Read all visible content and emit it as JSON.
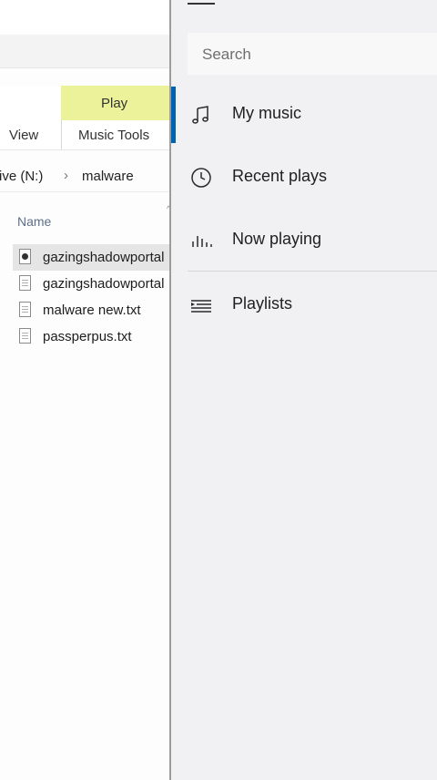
{
  "explorer": {
    "ribbon": {
      "view_tab": "View",
      "contextual_group": "Play",
      "contextual_tab": "Music Tools"
    },
    "breadcrumb": {
      "drive": "rive (N:)",
      "separator": "›",
      "folder": "malware"
    },
    "columns": {
      "name": "Name"
    },
    "files": [
      {
        "name": "gazingshadowportal",
        "icon": "audio-file-icon",
        "selected": true
      },
      {
        "name": "gazingshadowportal",
        "icon": "text-file-icon",
        "selected": false
      },
      {
        "name": "malware new.txt",
        "icon": "text-file-icon",
        "selected": false
      },
      {
        "name": "passperpus.txt",
        "icon": "text-file-icon",
        "selected": false
      }
    ]
  },
  "music_app": {
    "search": {
      "placeholder": "Search"
    },
    "nav": [
      {
        "label": "My music",
        "icon": "music-note-icon",
        "active": true
      },
      {
        "label": "Recent plays",
        "icon": "clock-icon",
        "active": false
      },
      {
        "label": "Now playing",
        "icon": "equalizer-icon",
        "active": false
      },
      {
        "label": "Playlists",
        "icon": "playlist-icon",
        "active": false
      }
    ],
    "colors": {
      "accent": "#0063b1",
      "pane_bg": "#f1f0f2",
      "contextual_tab": "#ebf29a"
    }
  }
}
